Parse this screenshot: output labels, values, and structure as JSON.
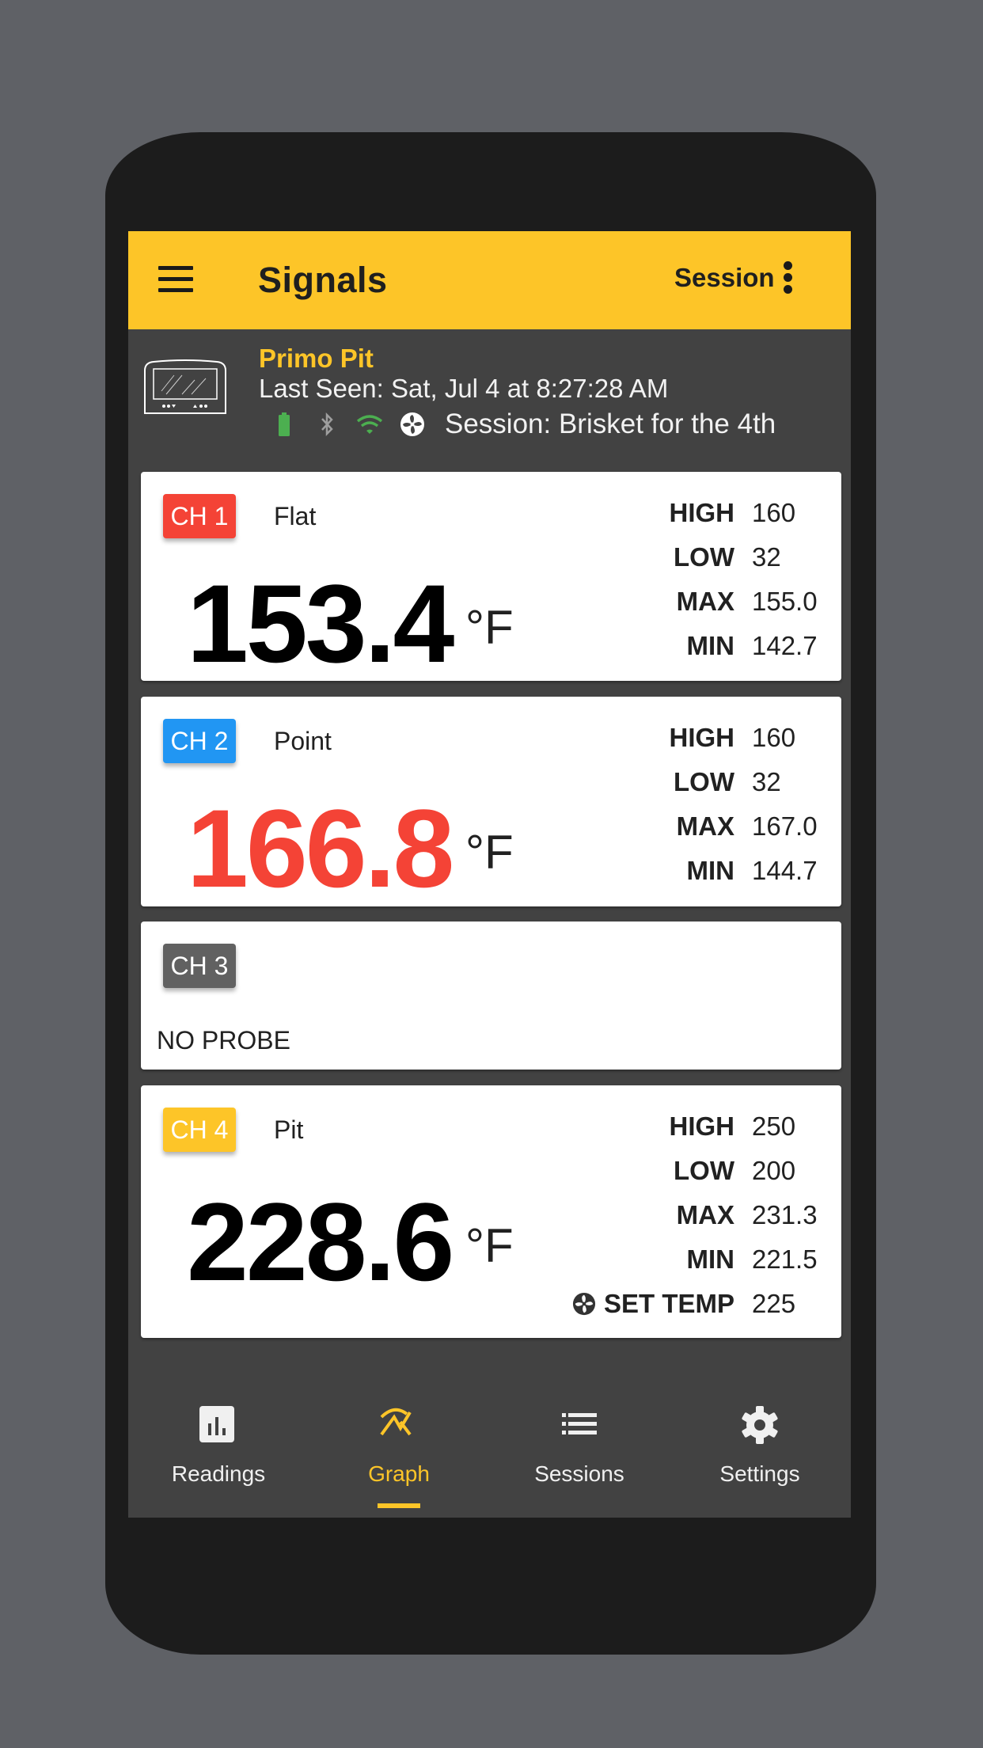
{
  "app": {
    "title": "Signals",
    "session_button": "Session"
  },
  "device": {
    "name": "Primo Pit",
    "last_seen": "Last Seen: Sat, Jul 4 at 8:27:28 AM",
    "session": "Session: Brisket for the 4th",
    "status_icons": [
      "battery-full-icon",
      "bluetooth-icon",
      "wifi-icon",
      "fan-icon"
    ],
    "colors": {
      "battery": "#4caf50",
      "bluetooth": "#9e9e9e",
      "wifi": "#4caf50",
      "fan": "#ffffff"
    }
  },
  "channels": [
    {
      "badge": "CH 1",
      "badge_color": "#f44336",
      "name": "Flat",
      "temp": "153.4",
      "unit": "°F",
      "temp_color": "#000000",
      "stats": [
        {
          "label": "HIGH",
          "value": "160"
        },
        {
          "label": "LOW",
          "value": "32"
        },
        {
          "label": "MAX",
          "value": "155.0"
        },
        {
          "label": "MIN",
          "value": "142.7"
        }
      ]
    },
    {
      "badge": "CH 2",
      "badge_color": "#2196f3",
      "name": "Point",
      "temp": "166.8",
      "unit": "°F",
      "temp_color": "#f44336",
      "stats": [
        {
          "label": "HIGH",
          "value": "160"
        },
        {
          "label": "LOW",
          "value": "32"
        },
        {
          "label": "MAX",
          "value": "167.0"
        },
        {
          "label": "MIN",
          "value": "144.7"
        }
      ]
    },
    {
      "badge": "CH 3",
      "badge_color": "#616161",
      "status": "NO PROBE"
    },
    {
      "badge": "CH 4",
      "badge_color": "#fdc528",
      "name": "Pit",
      "temp": "228.6",
      "unit": "°F",
      "temp_color": "#000000",
      "stats": [
        {
          "label": "HIGH",
          "value": "250"
        },
        {
          "label": "LOW",
          "value": "200"
        },
        {
          "label": "MAX",
          "value": "231.3"
        },
        {
          "label": "MIN",
          "value": "221.5"
        },
        {
          "label": "SET TEMP",
          "value": "225",
          "icon": "fan-icon"
        }
      ]
    }
  ],
  "nav": {
    "active": "Graph",
    "accent": "#fdc528",
    "items": [
      {
        "label": "Readings",
        "icon": "bar-chart-icon"
      },
      {
        "label": "Graph",
        "icon": "graph-icon"
      },
      {
        "label": "Sessions",
        "icon": "list-icon"
      },
      {
        "label": "Settings",
        "icon": "gear-icon"
      }
    ]
  }
}
